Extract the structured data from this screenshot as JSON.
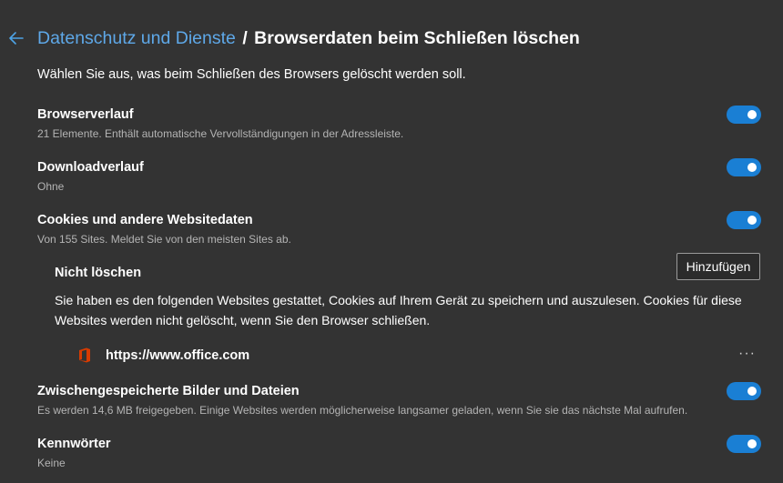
{
  "header": {
    "back_icon": "arrow-left-icon",
    "parent_link": "Datenschutz und Dienste",
    "separator": "/",
    "current": "Browserdaten beim Schließen löschen"
  },
  "intro": "Wählen Sie aus, was beim Schließen des Browsers gelöscht werden soll.",
  "settings": [
    {
      "title": "Browserverlauf",
      "desc": "21 Elemente. Enthält automatische Vervollständigungen in der Adressleiste.",
      "enabled": true
    },
    {
      "title": "Downloadverlauf",
      "desc": "Ohne",
      "enabled": true
    },
    {
      "title": "Cookies und andere Websitedaten",
      "desc": "Von 155 Sites. Meldet Sie von den meisten Sites ab.",
      "enabled": true
    },
    {
      "title": "Zwischengespeicherte Bilder und Dateien",
      "desc": "Es werden 14,6 MB freigegeben. Einige Websites werden möglicherweise langsamer geladen, wenn Sie sie das nächste Mal aufrufen.",
      "enabled": true
    },
    {
      "title": "Kennwörter",
      "desc": "Keine",
      "enabled": true
    }
  ],
  "exceptions": {
    "title": "Nicht löschen",
    "add_label": "Hinzufügen",
    "desc": "Sie haben es den folgenden Websites gestattet, Cookies auf Ihrem Gerät zu speichern und auszulesen. Cookies für diese Websites werden nicht gelöscht, wenn Sie den Browser schließen.",
    "sites": [
      {
        "url": "https://www.office.com",
        "icon": "office-icon",
        "more_label": "···"
      }
    ]
  },
  "colors": {
    "background": "#333333",
    "accent": "#1a7fd4",
    "link": "#5ea8e8",
    "office": "#d83b01"
  }
}
